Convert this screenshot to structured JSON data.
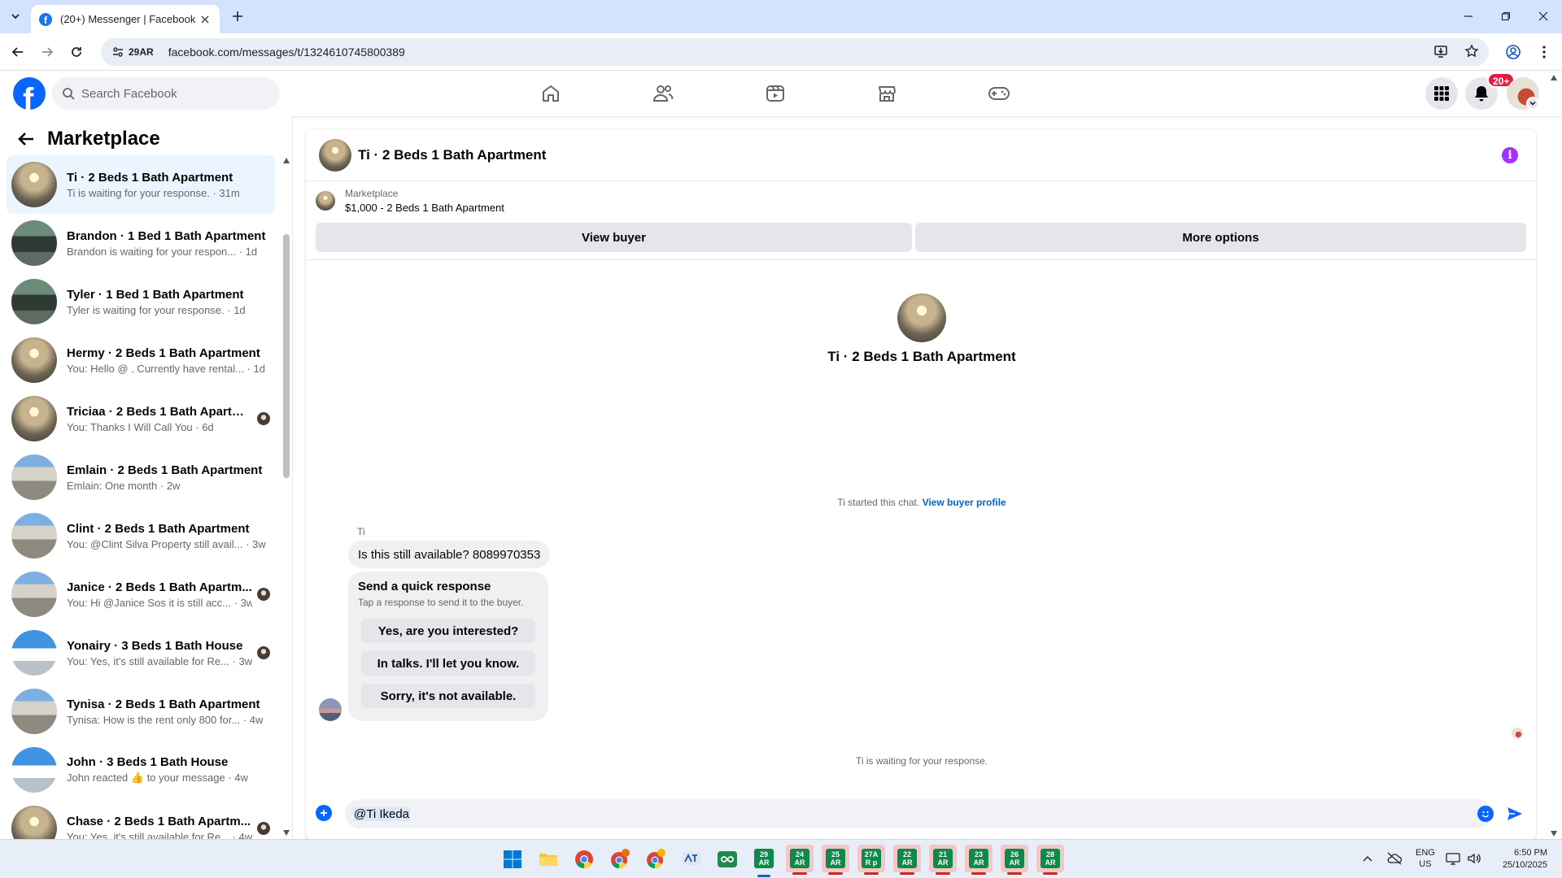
{
  "browser": {
    "tab_title": "(20+) Messenger | Facebook",
    "site_chip": "29AR",
    "url": "facebook.com/messages/t/1324610745800389"
  },
  "fb": {
    "search_placeholder": "Search Facebook",
    "notification_count": "20+",
    "brand_color": "#0866ff"
  },
  "sidebar": {
    "title": "Marketplace",
    "conversations": [
      {
        "name": "Ti · 2 Beds 1 Bath Apartment",
        "preview": "Ti is waiting for your response. · 31m",
        "active": true,
        "avatar": "room"
      },
      {
        "name": "Brandon · 1 Bed 1 Bath Apartment",
        "preview": "Brandon is waiting for your respon... · 1d",
        "avatar": "dark"
      },
      {
        "name": "Tyler · 1 Bed 1 Bath Apartment",
        "preview": "Tyler is waiting for your response. · 1d",
        "avatar": "dark"
      },
      {
        "name": "Hermy · 2 Beds 1 Bath Apartment",
        "preview": "You: Hello @ . Currently have rental... · 1d",
        "avatar": "room"
      },
      {
        "name": "Triciaa · 2 Beds 1 Bath Apartm...",
        "preview": "You: Thanks I Will Call You · 6d",
        "avatar": "room",
        "seen": true
      },
      {
        "name": "Emlain · 2 Beds 1 Bath Apartment",
        "preview": "Emlain: One month · 2w",
        "avatar": "building"
      },
      {
        "name": "Clint · 2 Beds 1 Bath Apartment",
        "preview": "You: @Clint Silva Property still avail... · 3w",
        "avatar": "building"
      },
      {
        "name": "Janice · 2 Beds 1 Bath Apartm...",
        "preview": "You: Hi @Janice Sos it is still acc... · 3w",
        "avatar": "building",
        "seen": true
      },
      {
        "name": "Yonairy · 3 Beds 1 Bath House",
        "preview": "You: Yes, it's still available for Re... · 3w",
        "avatar": "house",
        "seen": true
      },
      {
        "name": "Tynisa · 2 Beds 1 Bath Apartment",
        "preview": "Tynisa: How is the rent only 800 for... · 4w",
        "avatar": "building"
      },
      {
        "name": "John · 3 Beds 1 Bath House",
        "preview": "John reacted 👍 to your message · 4w",
        "avatar": "house"
      },
      {
        "name": "Chase · 2 Beds 1 Bath Apartm...",
        "preview": "You: Yes, it's still available for Re... · 4w",
        "avatar": "room",
        "seen": true
      }
    ]
  },
  "chat": {
    "title": "Ti · 2 Beds 1 Bath Apartment",
    "listing_label": "Marketplace",
    "listing_price": "$1,000 - 2 Beds 1 Bath Apartment",
    "view_buyer": "View buyer",
    "more_options": "More options",
    "hero_title": "Ti · 2 Beds 1 Bath Apartment",
    "started_text": "Ti started this chat.",
    "view_buyer_profile": "View buyer profile",
    "sender": "Ti",
    "message": "Is this still available? 8089970353",
    "quick_title": "Send a quick response",
    "quick_sub": "Tap a response to send it to the buyer.",
    "quick_responses": [
      "Yes, are you interested?",
      "In talks. I'll let you know.",
      "Sorry, it's not available."
    ],
    "waiting_text": "Ti is waiting for your response.",
    "composer_value": "@Ti Ikeda"
  },
  "taskbar": {
    "sheet_apps": [
      {
        "label": "29\nAR",
        "active": true
      },
      {
        "label": "24\nAR"
      },
      {
        "label": "25\nAR"
      },
      {
        "label": "27A\nR p"
      },
      {
        "label": "22\nAR"
      },
      {
        "label": "21\nAR"
      },
      {
        "label": "23\nAR"
      },
      {
        "label": "26\nAR"
      },
      {
        "label": "28\nAR"
      }
    ],
    "lang_line1": "ENG",
    "lang_line2": "US",
    "time": "6:50 PM",
    "date": "25/10/2025"
  }
}
